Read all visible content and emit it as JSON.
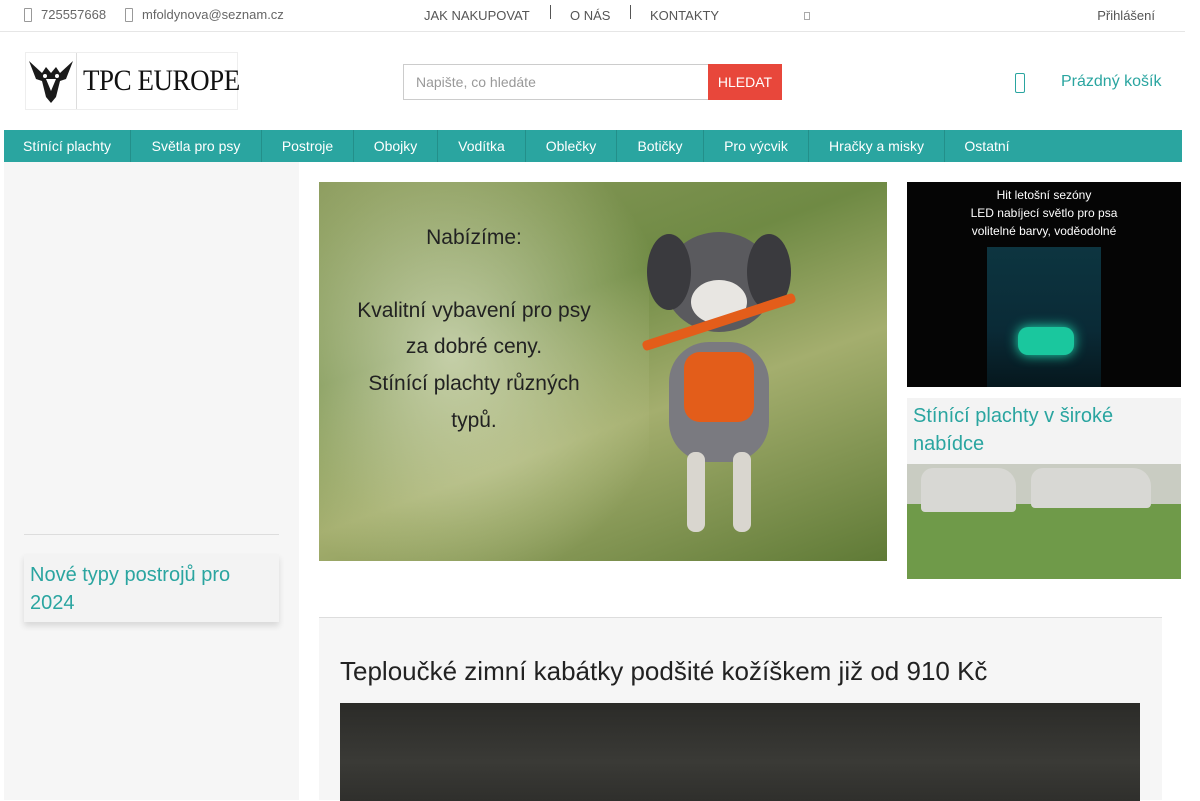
{
  "topbar": {
    "phone": "725557668",
    "email": "mfoldynova@seznam.cz",
    "nav": [
      "JAK NAKUPOVAT",
      "O NÁS",
      "KONTAKTY"
    ],
    "login": "Přihlášení"
  },
  "header": {
    "logo_text": "TPC EUROPE",
    "search_placeholder": "Napište, co hledáte",
    "search_button": "HLEDAT",
    "cart_text": "Prázdný košík"
  },
  "categories": [
    "Stínící plachty",
    "Světla pro psy",
    "Postroje",
    "Obojky",
    "Vodítka",
    "Oblečky",
    "Botičky",
    "Pro výcvik",
    "Hračky a misky",
    "Ostatní"
  ],
  "left_card": {
    "title": "Nové typy postrojů pro 2024"
  },
  "hero": {
    "line1": "Nabízíme:",
    "line2": "Kvalitní vybavení pro psy",
    "line3": "za dobré ceny.",
    "line4": "Stínící plachty různých",
    "line5": "typů."
  },
  "promo_led": {
    "line1": "Hit letošní sezóny",
    "line2": "LED nabíjecí světlo pro psa",
    "line3": "volitelné barvy, voděodolné"
  },
  "promo_covers": {
    "title": "Stínící plachty v široké nabídce"
  },
  "article": {
    "title": "Teploučké zimní kabátky podšité kožíškem již od 910 Kč"
  },
  "colors": {
    "accent": "#2aa5a0",
    "search_button": "#e8473b"
  }
}
